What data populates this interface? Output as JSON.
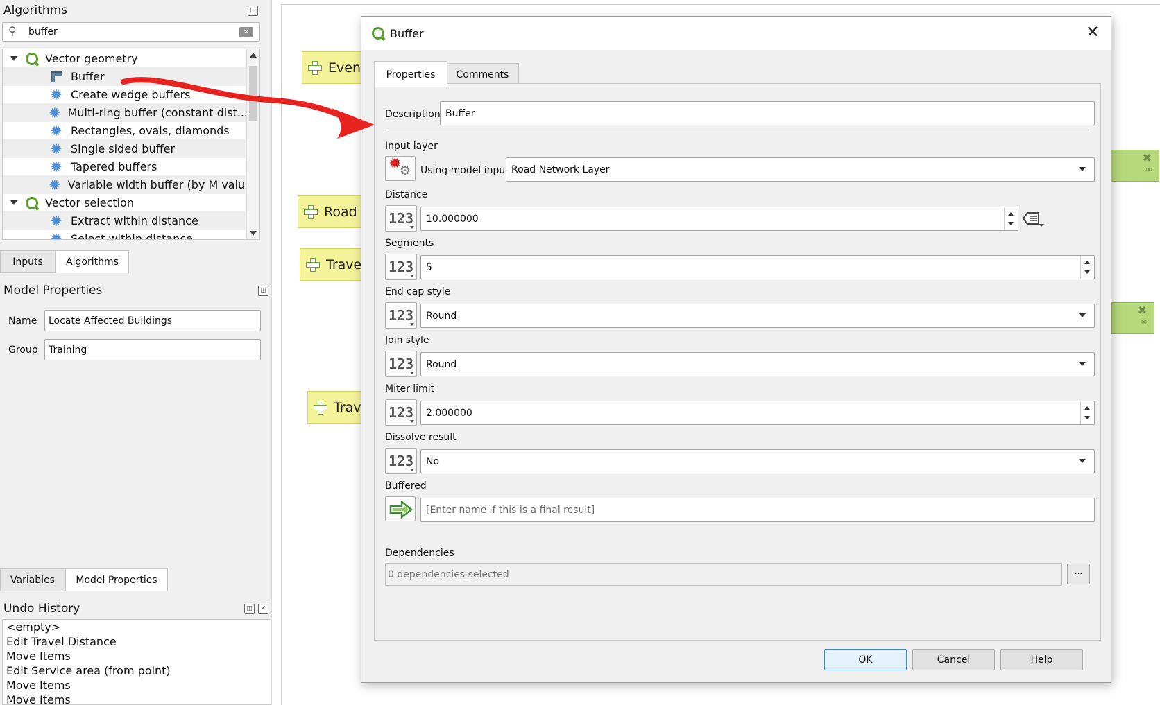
{
  "toolbox": {
    "title": "Algorithms",
    "search": {
      "value": "buffer",
      "placeholder": ""
    },
    "groups": [
      {
        "name": "Vector geometry",
        "items": [
          "Buffer",
          "Create wedge buffers",
          "Multi-ring buffer (constant dist...",
          "Rectangles, ovals, diamonds",
          "Single sided buffer",
          "Tapered buffers",
          "Variable width buffer (by M value)"
        ]
      },
      {
        "name": "Vector selection",
        "items": [
          "Extract within distance",
          "Select within distance"
        ]
      }
    ],
    "tabs": [
      "Inputs",
      "Algorithms"
    ]
  },
  "model_properties": {
    "title": "Model Properties",
    "name_label": "Name",
    "name_value": "Locate Affected Buildings",
    "group_label": "Group",
    "group_value": "Training",
    "tabs": [
      "Variables",
      "Model Properties"
    ]
  },
  "undo_history": {
    "title": "Undo History",
    "items": [
      "<empty>",
      "Edit Travel Distance",
      "Move Items",
      "Edit Service area (from point)",
      "Move Items",
      "Move Items"
    ]
  },
  "canvas": {
    "nodes": [
      "Event",
      "Road N",
      "Travel",
      "Trave"
    ]
  },
  "dialog": {
    "title": "Buffer",
    "tabs": [
      "Properties",
      "Comments"
    ],
    "description_label": "Description",
    "description_value": "Buffer",
    "input_layer_label": "Input layer",
    "input_layer_source": "Using model input",
    "input_layer_value": "Road Network Layer",
    "distance_label": "Distance",
    "distance_value": "10.000000",
    "segments_label": "Segments",
    "segments_value": "5",
    "end_cap_label": "End cap style",
    "end_cap_value": "Round",
    "join_label": "Join style",
    "join_value": "Round",
    "miter_label": "Miter limit",
    "miter_value": "2.000000",
    "dissolve_label": "Dissolve result",
    "dissolve_value": "No",
    "buffered_label": "Buffered",
    "buffered_placeholder": "[Enter name if this is a final result]",
    "dependencies_label": "Dependencies",
    "dependencies_value": "0 dependencies selected",
    "dependencies_button": "...",
    "number_icon": "123",
    "buttons": {
      "ok": "OK",
      "cancel": "Cancel",
      "help": "Help"
    }
  },
  "colors": {
    "arrow": "#e8231f",
    "node_yellow": "#f4f39a",
    "node_green": "#b6d97b",
    "qgis_green": "#5aa02c"
  }
}
